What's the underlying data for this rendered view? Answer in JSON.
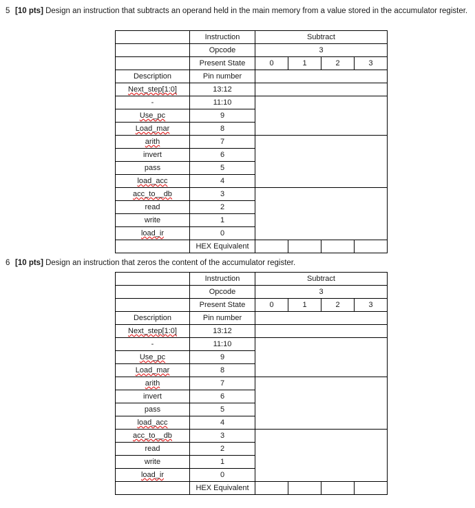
{
  "document": {
    "problems": [
      {
        "number": "5",
        "points_label": "[10 pts]",
        "statement": "Design an instruction that subtracts an operand held in the main memory from a value stored in the accumulator register."
      },
      {
        "number": "6",
        "points_label": "[10 pts]",
        "statement": "Design an instruction that zeros the content of the accumulator register."
      }
    ],
    "table": {
      "headers": {
        "instruction_label": "Instruction",
        "instruction_value": "Subtract",
        "opcode_label": "Opcode",
        "opcode_value": "3",
        "present_state_label": "Present State",
        "present_states": [
          "0",
          "1",
          "2",
          "3"
        ],
        "description_label": "Description",
        "pin_number_label": "Pin number"
      },
      "rows": [
        {
          "description": "Next_step[1:0]",
          "pin": "13:12",
          "spell_error": true
        },
        {
          "description": "-",
          "pin": "11:10",
          "spell_error": false
        },
        {
          "description": "Use_pc",
          "pin": "9",
          "spell_error": true
        },
        {
          "description": "Load_mar",
          "pin": "8",
          "spell_error": true
        },
        {
          "description": "arith",
          "pin": "7",
          "spell_error": true
        },
        {
          "description": "invert",
          "pin": "6",
          "spell_error": false
        },
        {
          "description": "pass",
          "pin": "5",
          "spell_error": false
        },
        {
          "description": "load_acc",
          "pin": "4",
          "spell_error": true
        },
        {
          "description": "acc_to__db",
          "pin": "3",
          "spell_error": true
        },
        {
          "description": "read",
          "pin": "2",
          "spell_error": false
        },
        {
          "description": "write",
          "pin": "1",
          "spell_error": false
        },
        {
          "description": "load_ir",
          "pin": "0",
          "spell_error": true
        }
      ],
      "footer": {
        "hex_label": "HEX Equivalent",
        "hex_values": [
          "",
          "",
          "",
          ""
        ]
      },
      "answer_blocks": [
        {
          "spans_rows": 1,
          "value": ""
        },
        {
          "spans_rows": 3,
          "value": ""
        },
        {
          "spans_rows": 4,
          "value": ""
        },
        {
          "spans_rows": 4,
          "value": ""
        }
      ]
    }
  }
}
